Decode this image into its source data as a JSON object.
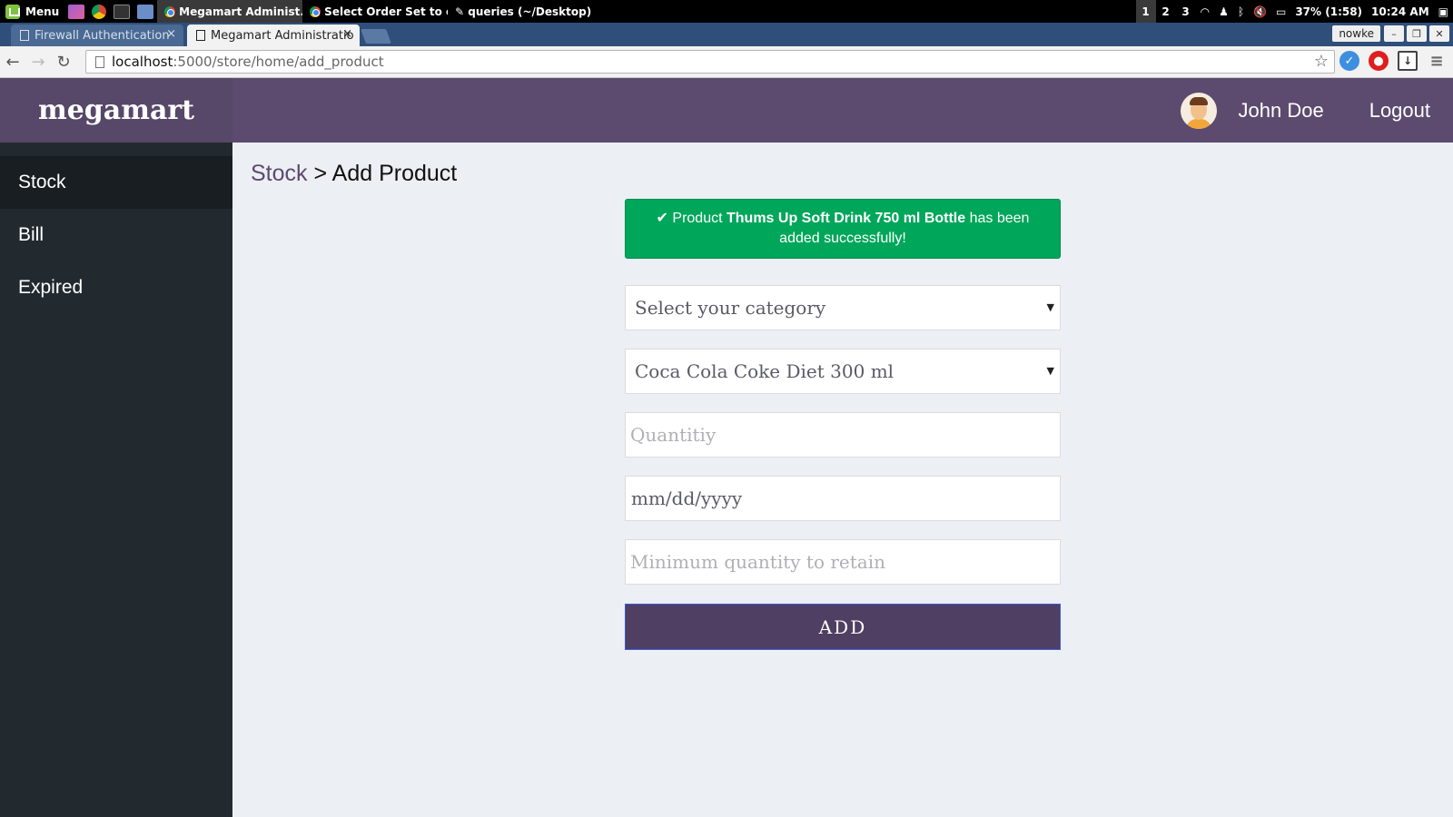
{
  "taskbar": {
    "menu_label": "Menu",
    "windows": [
      {
        "title": "Megamart Administ...",
        "active": true
      },
      {
        "title": "Select Order Set to c...",
        "active": false
      },
      {
        "title": "queries (~/Desktop) ...",
        "active": false
      }
    ],
    "workspaces": [
      "1",
      "2",
      "3"
    ],
    "battery": "37% (1:58)",
    "clock": "10:24 AM"
  },
  "browser": {
    "tabs": [
      {
        "title": "Firewall Authentication",
        "active": false
      },
      {
        "title": "Megamart Administratio",
        "active": true
      }
    ],
    "profile_name": "nowke",
    "url_host": "localhost",
    "url_path": ":5000/store/home/add_product"
  },
  "app": {
    "brand": "megamart",
    "user_name": "John Doe",
    "logout_label": "Logout",
    "sidebar": [
      {
        "label": "Stock",
        "active": true
      },
      {
        "label": "Bill",
        "active": false
      },
      {
        "label": "Expired",
        "active": false
      }
    ],
    "breadcrumb": {
      "parent": "Stock",
      "separator": " > ",
      "current": "Add Product"
    },
    "alert": {
      "prefix": "Product",
      "product": "Thums Up Soft Drink 750 ml Bottle",
      "suffix": "has been added successfully!",
      "color": "#00a65a"
    },
    "form": {
      "category_select": "Select your category",
      "product_select": "Coca Cola Coke Diet 300 ml",
      "quantity_placeholder": "Quantitiy",
      "date_placeholder": "mm/dd/yyyy",
      "min_quantity_placeholder": "Minimum quantity to retain",
      "submit_label": "ADD"
    },
    "colors": {
      "header": "#5c4b6e",
      "sidebar": "#222a30",
      "button": "#4f3f62"
    }
  }
}
